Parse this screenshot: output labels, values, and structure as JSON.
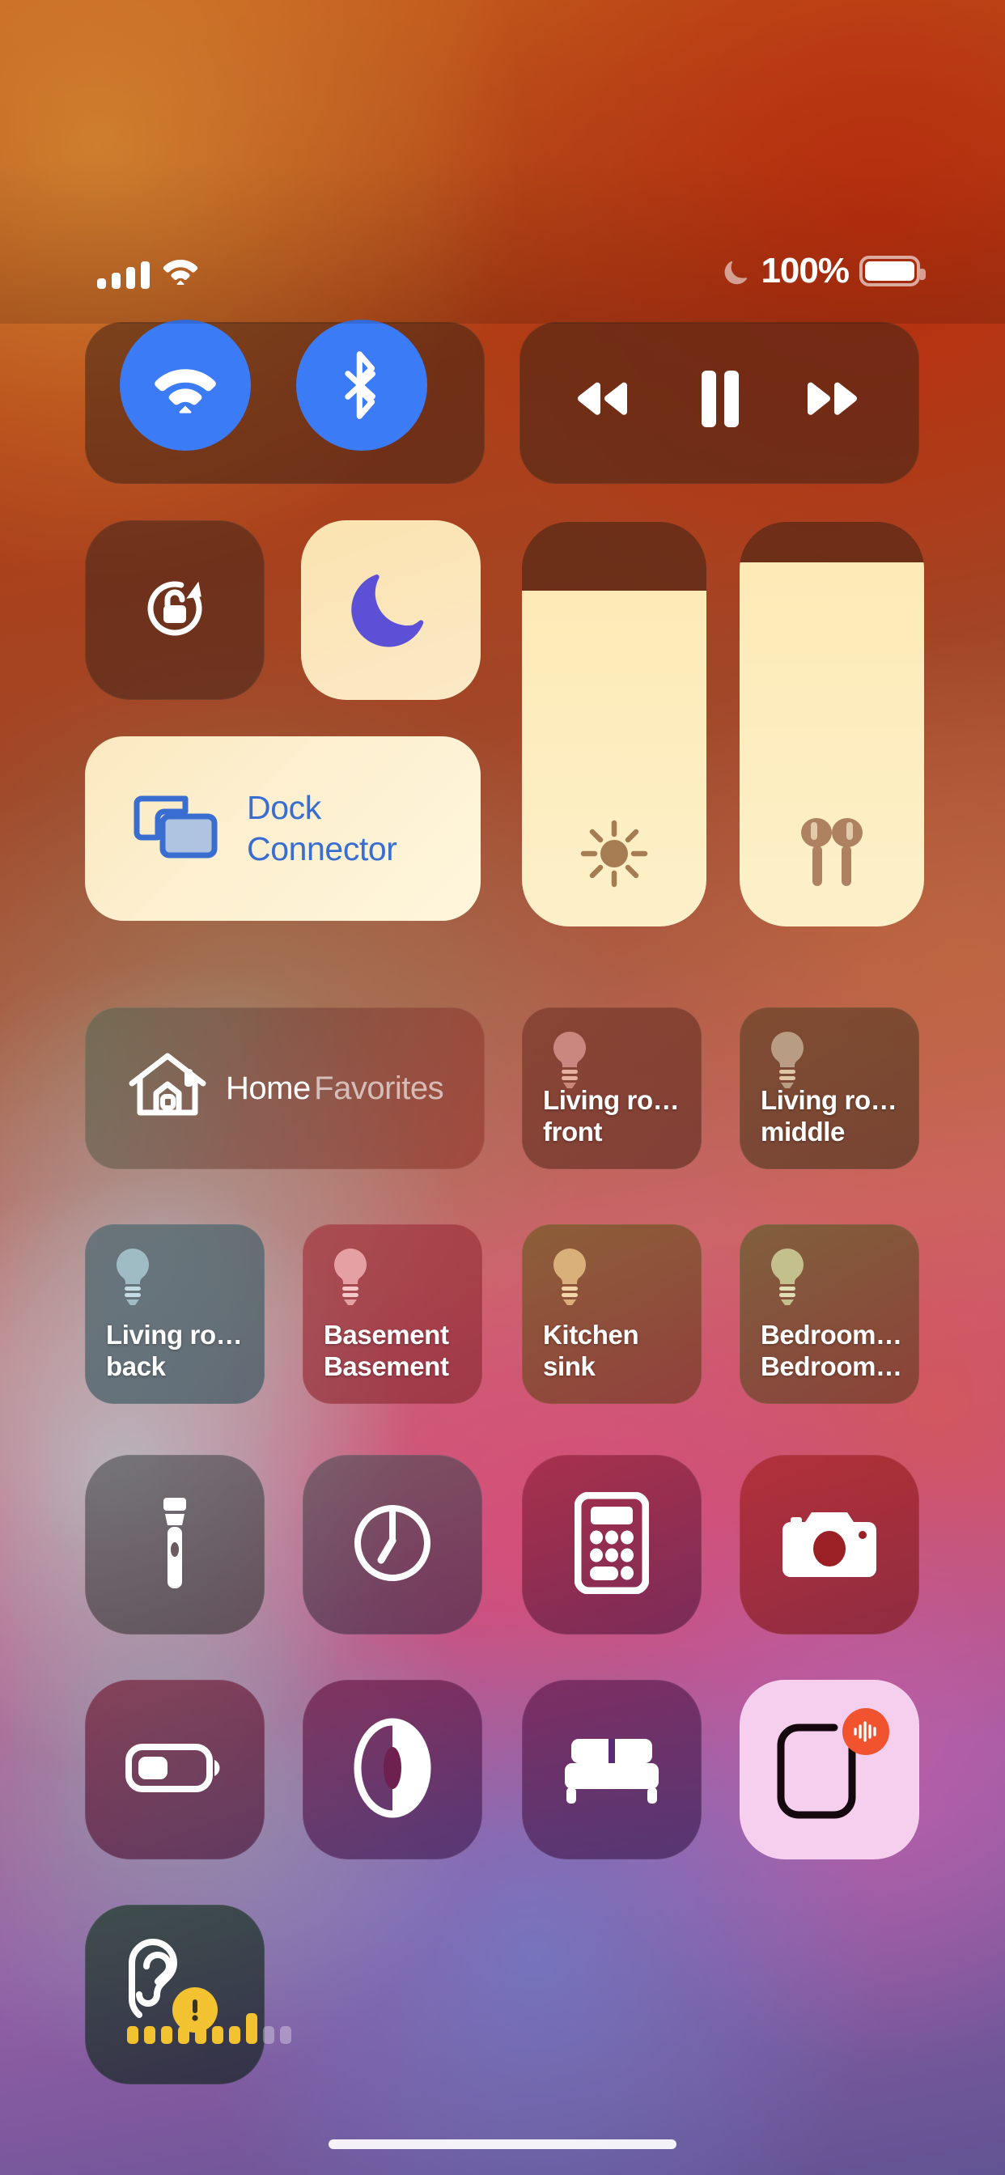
{
  "status_bar": {
    "signal_icon": "cellular-signal-icon",
    "signal_bars": 4,
    "wifi_icon": "wifi-icon",
    "dnd_icon": "crescent-moon-icon",
    "battery_percent": "100%",
    "battery_level": 100,
    "battery_icon": "battery-full-icon"
  },
  "connectivity": {
    "group_name": "connectivity-group",
    "wifi": {
      "name": "wifi-toggle",
      "state": "on",
      "color": "#3C7BF6",
      "icon": "wifi-icon"
    },
    "bluetooth": {
      "name": "bluetooth-toggle",
      "state": "on",
      "color": "#3C7BF6",
      "icon": "bluetooth-icon"
    }
  },
  "media": {
    "group_name": "now-playing-group",
    "rewind": {
      "icon": "rewind-icon"
    },
    "pause": {
      "icon": "pause-icon"
    },
    "forward": {
      "icon": "fast-forward-icon"
    }
  },
  "toggles": {
    "rotation_lock": {
      "label": "Rotation Lock",
      "icon": "rotation-lock-icon",
      "state": "off"
    },
    "do_not_disturb": {
      "label": "Do Not Disturb",
      "icon": "crescent-moon-icon",
      "state": "on",
      "accent": "#5B50D6"
    }
  },
  "screen_mirroring": {
    "icon": "screen-mirroring-icon",
    "line1": "Dock",
    "line2": "Connector",
    "state": "connected",
    "text_color": "#3A6DD0"
  },
  "sliders": {
    "brightness": {
      "icon": "sun-icon",
      "value": 83
    },
    "volume": {
      "icon": "airpods-icon",
      "value": 90
    }
  },
  "home": {
    "icon": "house-icon",
    "title": "Home",
    "subtitle": "Favorites"
  },
  "home_accessories": [
    {
      "icon": "lightbulb-icon",
      "line1": "Living ro…",
      "line2": "front",
      "tint": "#C9877F"
    },
    {
      "icon": "lightbulb-icon",
      "line1": "Living ro…",
      "line2": "middle",
      "tint": "#B99C84"
    },
    {
      "icon": "lightbulb-icon",
      "line1": "Living ro…",
      "line2": "back",
      "tint": "#9FBCC4"
    },
    {
      "icon": "lightbulb-icon",
      "line1": "Basement",
      "line2": "Basement",
      "tint": "#E4A0A3"
    },
    {
      "icon": "lightbulb-icon",
      "line1": "Kitchen",
      "line2": "sink",
      "tint": "#D9B07A"
    },
    {
      "icon": "lightbulb-icon",
      "line1": "Bedroom…",
      "line2": "Bedroom…",
      "tint": "#C3C08E"
    }
  ],
  "utilities": [
    {
      "name": "flashlight",
      "icon": "flashlight-icon",
      "state": "off"
    },
    {
      "name": "timer",
      "icon": "timer-icon",
      "state": "off"
    },
    {
      "name": "calculator",
      "icon": "calculator-icon",
      "state": "off"
    },
    {
      "name": "camera",
      "icon": "camera-icon",
      "state": "off"
    },
    {
      "name": "low-power-mode",
      "icon": "battery-low-icon",
      "state": "off"
    },
    {
      "name": "dark-mode",
      "icon": "dark-mode-icon",
      "state": "off"
    },
    {
      "name": "sleep-mode",
      "icon": "bed-icon",
      "state": "off"
    },
    {
      "name": "screen-recording",
      "icon": "screen-recording-icon",
      "state": "on",
      "badge": "recording-badge",
      "badge_color": "#F0532E"
    },
    {
      "name": "hearing",
      "icon": "ear-icon",
      "state": "alert",
      "badge": "warning-badge",
      "badge_color": "#F2C230",
      "level_bars": 10,
      "level_active": 8
    }
  ],
  "home_indicator": {
    "name": "home-indicator"
  }
}
